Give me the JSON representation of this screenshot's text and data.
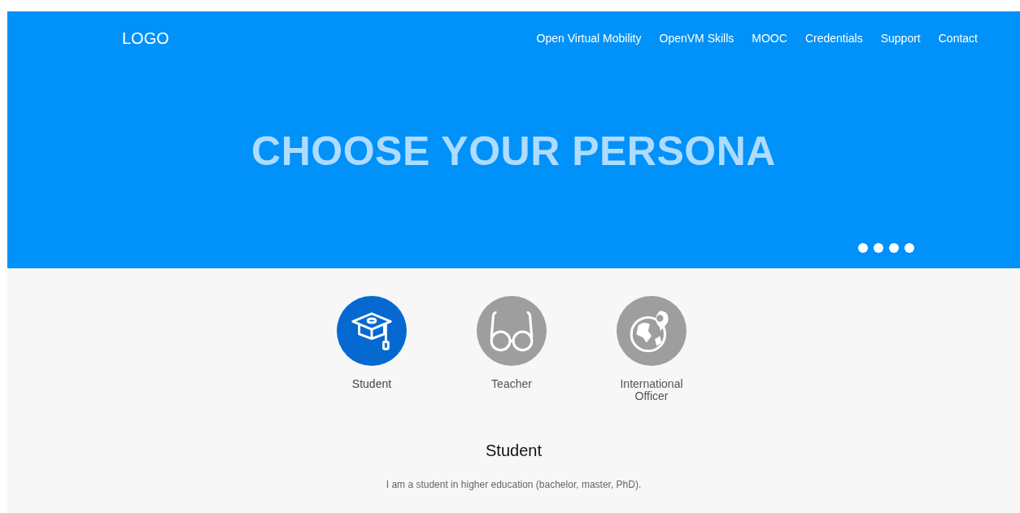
{
  "header": {
    "logo": "LOGO",
    "nav": [
      "Open Virtual Mobility",
      "OpenVM Skills",
      "MOOC",
      "Credentials",
      "Support",
      "Contact"
    ]
  },
  "hero": {
    "title": "CHOOSE YOUR PERSONA"
  },
  "personas": [
    {
      "kind": "cap",
      "label": "Student",
      "selected": true
    },
    {
      "kind": "glasses",
      "label": "Teacher",
      "selected": false
    },
    {
      "kind": "globe",
      "label": "International Officer",
      "selected": false
    }
  ],
  "detail": {
    "title": "Student",
    "text": "I am a student in higher education (bachelor, master, PhD)."
  }
}
